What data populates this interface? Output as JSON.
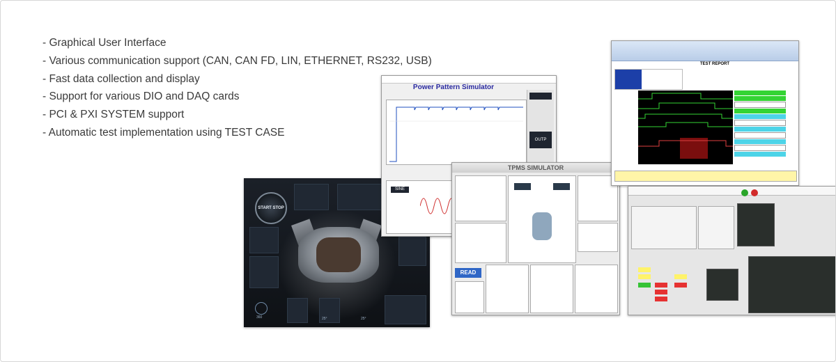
{
  "features": [
    "- Graphical User Interface",
    "- Various communication support (CAN, CAN FD, LIN, ETHERNET, RS232, USB)",
    "- Fast data collection and display",
    "- Support for various DIO and DAQ cards",
    "- PCI & PXI SYSTEM support",
    "- Automatic test implementation using TEST CASE"
  ],
  "car_hmi": {
    "start_button": "START STOP",
    "temp_left": "25°",
    "temp_right": "25°",
    "gauge": "360"
  },
  "power_pattern": {
    "title": "Power Pattern Simulator",
    "waveform_label": "SINE",
    "output_button": "OUTP"
  },
  "tpms": {
    "title": "TPMS SIMULATOR",
    "read_button": "READ"
  },
  "test_report": {
    "title": "TEST REPORT"
  },
  "colors": {
    "text": "#3a3a3a",
    "frame_border": "#d6d6d6"
  }
}
